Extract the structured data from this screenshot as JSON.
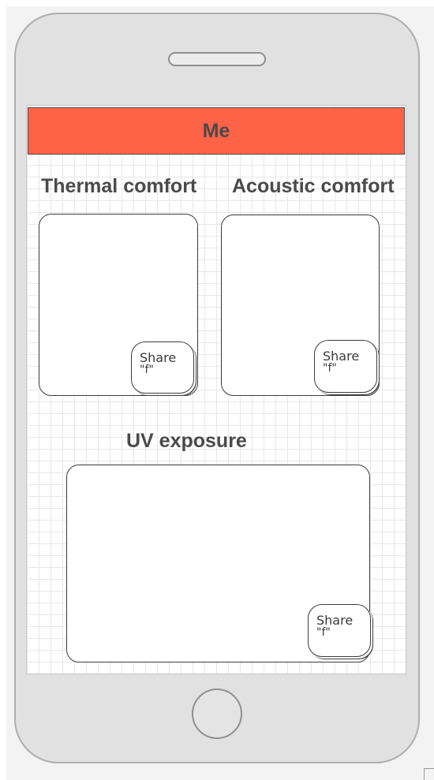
{
  "device": {
    "type": "mobile-phone-mockup"
  },
  "header": {
    "title": "Me",
    "color": "#ff6347"
  },
  "sections": [
    {
      "title": "Thermal comfort",
      "share": {
        "label": "Share",
        "sub": "\"f\""
      }
    },
    {
      "title": "Acoustic comfort",
      "share": {
        "label": "Share",
        "sub": "\"f\""
      }
    },
    {
      "title": "UV exposure",
      "share": {
        "label": "Share",
        "sub": "\"f\""
      }
    }
  ]
}
